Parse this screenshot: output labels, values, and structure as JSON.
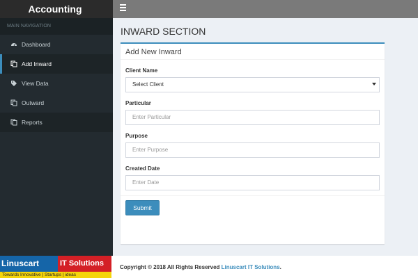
{
  "header": {
    "app_title": "Accounting"
  },
  "sidebar": {
    "section_header": "MAIN NAVIGATION",
    "items": [
      {
        "label": "Dashboard",
        "icon": "dashboard-icon"
      },
      {
        "label": "Add Inward",
        "icon": "copy-icon"
      },
      {
        "label": "View Data",
        "icon": "tag-icon"
      },
      {
        "label": "Outward",
        "icon": "copy-icon"
      },
      {
        "label": "Reports",
        "icon": "copy-icon"
      }
    ],
    "active_item": "Add Inward"
  },
  "main": {
    "section_title": "INWARD SECTION",
    "form": {
      "title": "Add New Inward",
      "client_label": "Client Name",
      "client_value": "Select Client",
      "particular_label": "Particular",
      "particular_placeholder": "Enter Particular",
      "purpose_label": "Purpose",
      "purpose_placeholder": "Enter Purpose",
      "date_label": "Created Date",
      "date_placeholder": "Enter Date",
      "submit_label": "Submit"
    }
  },
  "footer": {
    "logo_left": "Linuscart",
    "logo_right": "IT Solutions",
    "logo_tagline": "Towards Innovative  |  Startups  |  ideas",
    "copyright_prefix": "Copyright © 2018 All Rights Reserved ",
    "company": "Linuscart IT Solutions",
    "suffix": "."
  },
  "colors": {
    "accent": "#3c8dbc",
    "sidebar": "#232b30",
    "topbar": "#7a7a7a"
  }
}
